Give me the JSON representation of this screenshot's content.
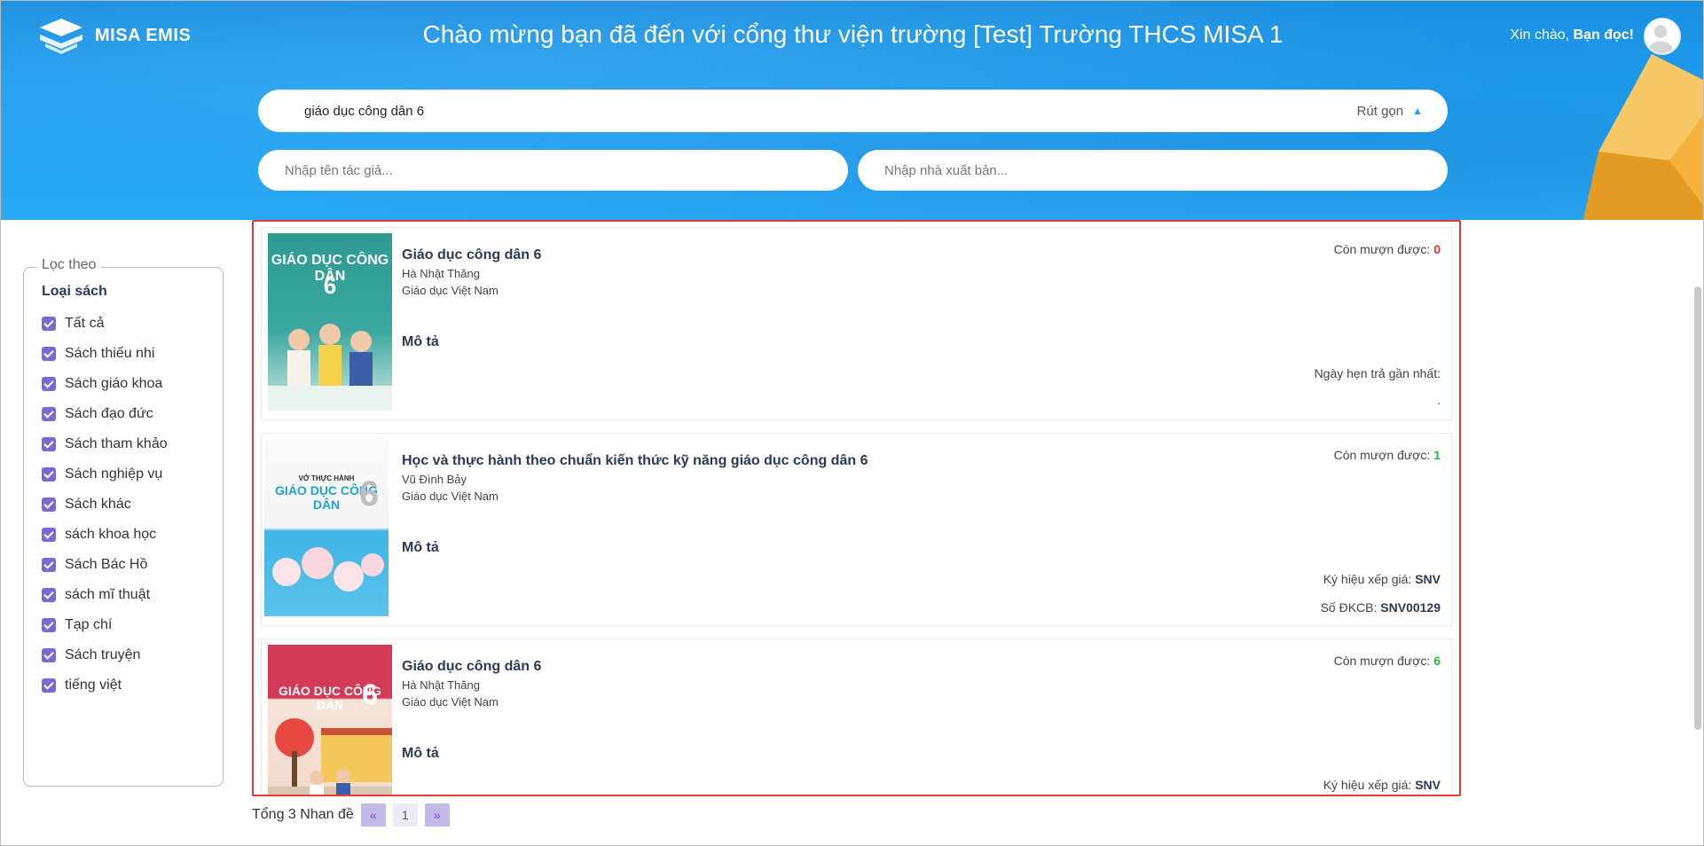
{
  "header": {
    "logo_text": "MISA EMIS",
    "welcome": "Chào mừng bạn đã đến với cổng thư viện trường [Test] Trường THCS MISA 1",
    "greeting_prefix": "Xin chào,",
    "greeting_name": "Bạn đọc!"
  },
  "search": {
    "query": "giáo dục công dân 6",
    "collapse_label": "Rút gọn",
    "author_placeholder": "Nhập tên tác giả...",
    "publisher_placeholder": "Nhập nhà xuất bản..."
  },
  "filter": {
    "legend": "Lọc theo",
    "group_title": "Loại sách",
    "items": [
      "Tất cả",
      "Sách thiếu nhi",
      "Sách giáo khoa",
      "Sách đạo đức",
      "Sách tham khảo",
      "Sách nghiệp vụ",
      "Sách khác",
      "sách khoa học",
      "Sách Bác Hồ",
      "sách mĩ thuật",
      "Tạp chí",
      "Sách truyện",
      "tiếng việt"
    ]
  },
  "results": [
    {
      "cover_title": "GIÁO DỤC CÔNG DÂN",
      "cover_number": "6",
      "title": "Giáo dục công dân 6",
      "author": "Hà Nhật Thăng",
      "publisher": "Giáo dục Việt Nam",
      "desc_label": "Mô tả",
      "available_label": "Còn mượn được:",
      "available_count": "0",
      "due_label": "Ngày hẹn trả gần nhất:",
      "due_value": "."
    },
    {
      "cover_kicker": "VỞ THỰC HÀNH",
      "cover_title": "GIÁO DỤC CÔNG DÂN",
      "cover_number": "6",
      "title": "Học và thực hành theo chuẩn kiến thức kỹ năng giáo dục công dân 6",
      "author": "Vũ Đình Bảy",
      "publisher": "Giáo dục Việt Nam",
      "desc_label": "Mô tả",
      "available_label": "Còn mượn được:",
      "available_count": "1",
      "shelf_label": "Ký hiệu xếp giá:",
      "shelf_value": "SNV",
      "reg_label": "Số ĐKCB:",
      "reg_value": "SNV00129"
    },
    {
      "cover_title": "GIÁO DỤC CÔNG DÂN",
      "cover_number": "6",
      "title": "Giáo dục công dân 6",
      "author": "Hà Nhật Thăng",
      "publisher": "Giáo dục Việt Nam",
      "desc_label": "Mô tả",
      "available_label": "Còn mượn được:",
      "available_count": "6",
      "shelf_label": "Ký hiệu xếp giá:",
      "shelf_value": "SNV"
    }
  ],
  "pager": {
    "total_text": "Tổng 3 Nhan đề",
    "prev": "«",
    "current": "1",
    "next": "»"
  }
}
